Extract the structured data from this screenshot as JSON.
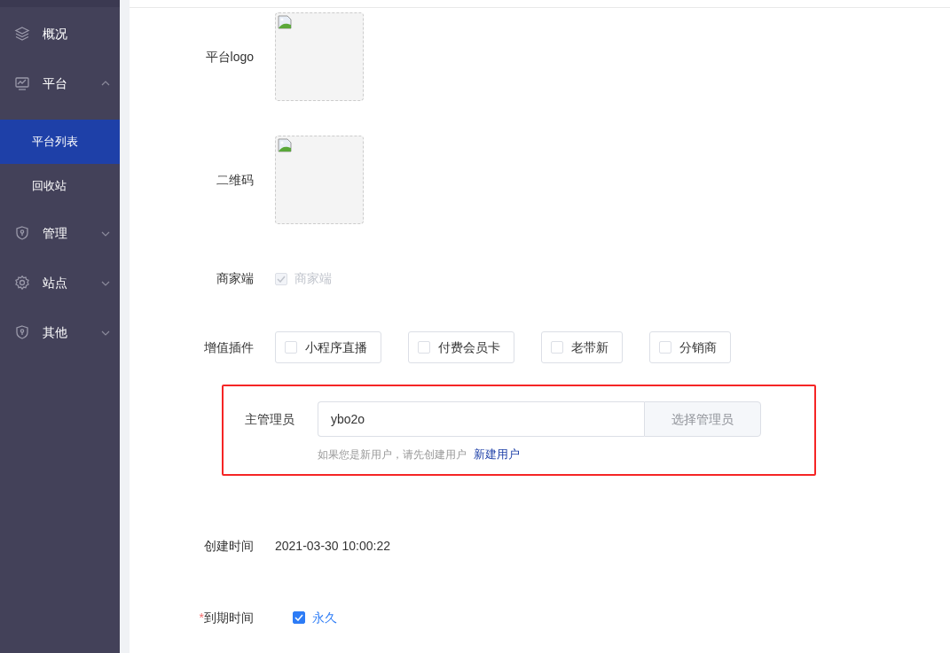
{
  "sidebar": {
    "items": [
      {
        "label": "概况",
        "kind": "link"
      },
      {
        "label": "平台",
        "kind": "group",
        "expanded": true,
        "children": [
          {
            "label": "平台列表",
            "selected": true
          },
          {
            "label": "回收站",
            "selected": false
          }
        ]
      },
      {
        "label": "管理",
        "kind": "group",
        "expanded": false
      },
      {
        "label": "站点",
        "kind": "group",
        "expanded": false
      },
      {
        "label": "其他",
        "kind": "group",
        "expanded": false
      }
    ]
  },
  "form": {
    "fields": [
      {
        "kind": "image",
        "label": "平台logo"
      },
      {
        "kind": "image",
        "label": "二维码"
      },
      {
        "kind": "checkbox",
        "label": "商家端",
        "option": {
          "label": "商家端",
          "checked": true,
          "disabled": true
        }
      },
      {
        "kind": "options",
        "label": "增值插件",
        "options": [
          {
            "label": "小程序直播",
            "checked": false
          },
          {
            "label": "付费会员卡",
            "checked": false
          },
          {
            "label": "老带新",
            "checked": false
          },
          {
            "label": "分销商",
            "checked": false
          }
        ]
      },
      {
        "kind": "admin",
        "label": "主管理员",
        "highlighted": true,
        "value": "ybo2o",
        "button": "选择管理员",
        "hint": "如果您是新用户，请先创建用户",
        "link": "新建用户"
      },
      {
        "kind": "text",
        "label": "创建时间",
        "value": "2021-03-30 10:00:22"
      },
      {
        "kind": "checkbox",
        "label": "到期时间",
        "required": true,
        "required_mark": "*",
        "option": {
          "label": "永久",
          "checked": true,
          "disabled": false
        }
      }
    ]
  }
}
